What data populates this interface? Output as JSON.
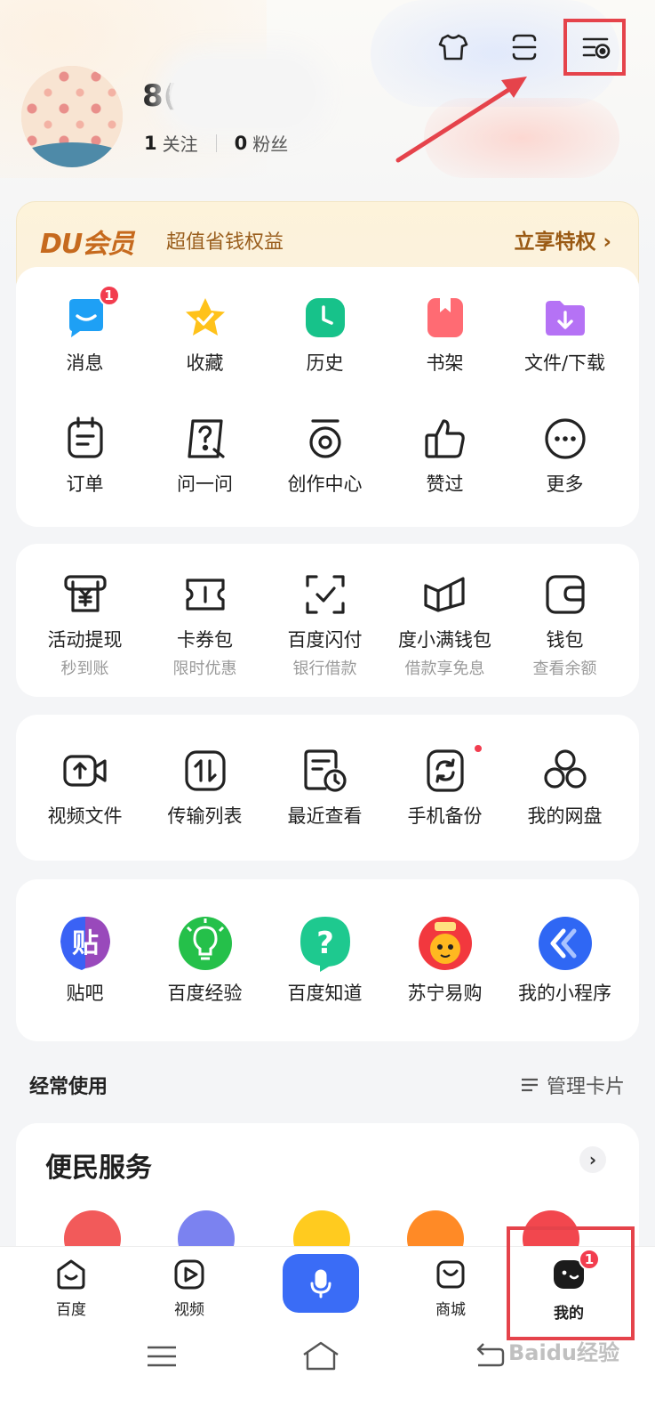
{
  "profile": {
    "username_visible": "8(",
    "following_count": "1",
    "following_label": "关注",
    "fans_count": "0",
    "fans_label": "粉丝"
  },
  "top_icons": [
    "tshirt-icon",
    "menu-scan-icon",
    "settings-list-icon"
  ],
  "vip": {
    "logo": "DU会员",
    "description": "超值省钱权益",
    "cta": "立享特权 ›"
  },
  "tools_row1": [
    {
      "label": "消息",
      "icon": "message-icon",
      "badge": "1"
    },
    {
      "label": "收藏",
      "icon": "star-icon"
    },
    {
      "label": "历史",
      "icon": "clock-icon"
    },
    {
      "label": "书架",
      "icon": "bookshelf-icon"
    },
    {
      "label": "文件/下载",
      "icon": "download-folder-icon"
    }
  ],
  "tools_row2": [
    {
      "label": "订单",
      "icon": "order-icon"
    },
    {
      "label": "问一问",
      "icon": "question-bubble-icon"
    },
    {
      "label": "创作中心",
      "icon": "creation-icon"
    },
    {
      "label": "赞过",
      "icon": "thumbs-up-icon"
    },
    {
      "label": "更多",
      "icon": "more-icon"
    }
  ],
  "finance": [
    {
      "label": "活动提现",
      "sub": "秒到账",
      "icon": "cash-withdraw-icon"
    },
    {
      "label": "卡券包",
      "sub": "限时优惠",
      "icon": "coupon-icon"
    },
    {
      "label": "百度闪付",
      "sub": "银行借款",
      "icon": "flash-pay-icon"
    },
    {
      "label": "度小满钱包",
      "sub": "借款享免息",
      "icon": "wallet-book-icon"
    },
    {
      "label": "钱包",
      "sub": "查看余额",
      "icon": "wallet-icon"
    }
  ],
  "netdisk": [
    {
      "label": "视频文件",
      "icon": "video-upload-icon"
    },
    {
      "label": "传输列表",
      "icon": "transfer-icon"
    },
    {
      "label": "最近查看",
      "icon": "recent-file-icon"
    },
    {
      "label": "手机备份",
      "icon": "phone-backup-icon",
      "dot": true
    },
    {
      "label": "我的网盘",
      "icon": "netdisk-icon"
    }
  ],
  "apps": [
    {
      "label": "贴吧",
      "icon": "tieba-icon"
    },
    {
      "label": "百度经验",
      "icon": "jingyan-icon"
    },
    {
      "label": "百度知道",
      "icon": "zhidao-icon"
    },
    {
      "label": "苏宁易购",
      "icon": "suning-icon"
    },
    {
      "label": "我的小程序",
      "icon": "mini-program-icon"
    }
  ],
  "frequent": {
    "title": "经常使用",
    "manage": "管理卡片"
  },
  "service": {
    "title": "便民服务",
    "more": "›"
  },
  "bottom_nav": [
    {
      "label": "百度",
      "icon": "baidu-home-icon"
    },
    {
      "label": "视频",
      "icon": "video-play-icon"
    },
    {
      "label": "",
      "icon": "microphone-icon"
    },
    {
      "label": "商城",
      "icon": "shop-bag-icon"
    },
    {
      "label": "我的",
      "icon": "me-face-icon",
      "badge": "1"
    }
  ],
  "watermark": "Baidu经验",
  "colors": {
    "accent_red": "#e5434b",
    "badge_red": "#f23d4f",
    "mic_blue": "#3a6cf6",
    "vip_gold": "#c66a1e"
  }
}
